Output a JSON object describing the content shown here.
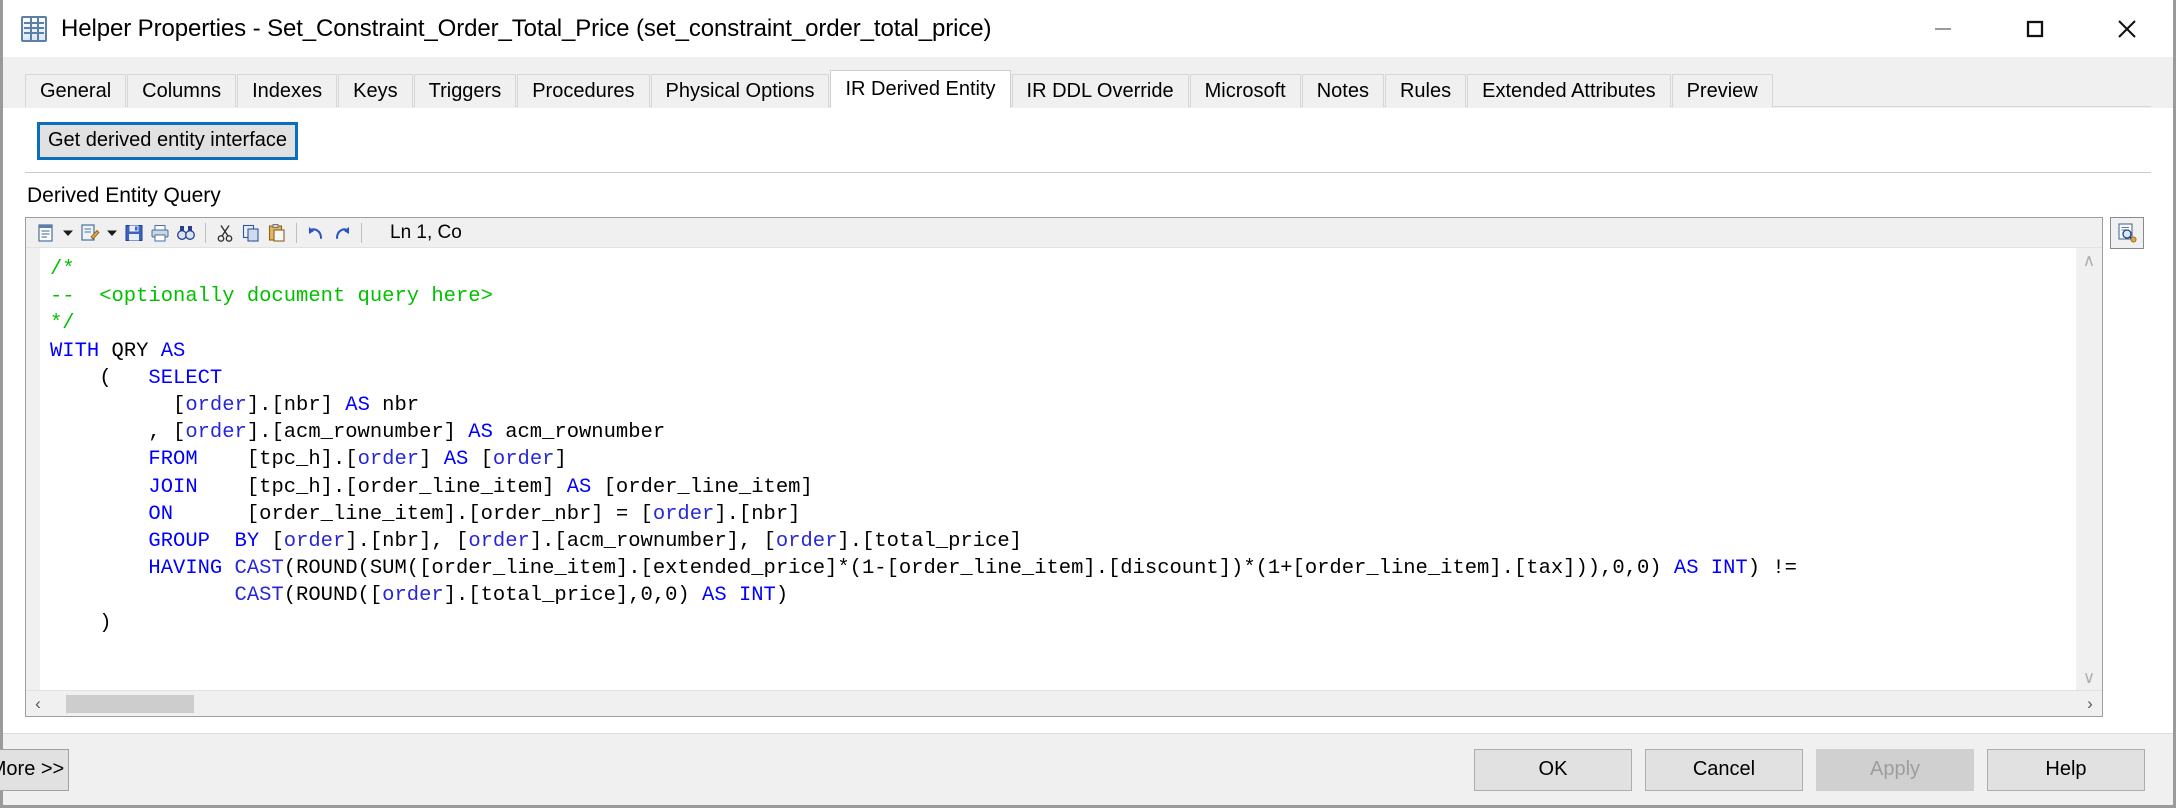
{
  "window": {
    "title": "Helper Properties - Set_Constraint_Order_Total_Price (set_constraint_order_total_price)",
    "icon": "table-grid-icon",
    "controls": {
      "minimize": "minimize-icon",
      "maximize": "maximize-icon",
      "close": "close-icon"
    }
  },
  "tabs": [
    {
      "label": "General",
      "active": false
    },
    {
      "label": "Columns",
      "active": false
    },
    {
      "label": "Indexes",
      "active": false
    },
    {
      "label": "Keys",
      "active": false
    },
    {
      "label": "Triggers",
      "active": false
    },
    {
      "label": "Procedures",
      "active": false
    },
    {
      "label": "Physical Options",
      "active": false
    },
    {
      "label": "IR Derived Entity",
      "active": true
    },
    {
      "label": "IR DDL Override",
      "active": false
    },
    {
      "label": "Microsoft",
      "active": false
    },
    {
      "label": "Notes",
      "active": false
    },
    {
      "label": "Rules",
      "active": false
    },
    {
      "label": "Extended Attributes",
      "active": false
    },
    {
      "label": "Preview",
      "active": false
    }
  ],
  "content": {
    "get_interface_button": "Get derived entity interface",
    "query_group_label": "Derived Entity Query"
  },
  "editor": {
    "toolbar": [
      {
        "name": "insert-template-icon",
        "caret": true
      },
      {
        "name": "edit-query-icon",
        "caret": true
      },
      {
        "name": "save-icon",
        "caret": false
      },
      {
        "name": "print-icon",
        "caret": false
      },
      {
        "name": "find-icon",
        "caret": false
      },
      {
        "name": "cut-icon",
        "caret": false
      },
      {
        "name": "copy-icon",
        "caret": false
      },
      {
        "name": "paste-icon",
        "caret": false
      },
      {
        "name": "undo-icon",
        "caret": false
      },
      {
        "name": "redo-icon",
        "caret": false
      }
    ],
    "cursor_position": "Ln 1, Co",
    "side_button_icon": "preview-query-icon",
    "scroll": {
      "up_arrow": "∧",
      "down_arrow": "∨",
      "left_arrow": "‹",
      "right_arrow": "›"
    },
    "code_lines": [
      [
        {
          "t": "/*",
          "c": "cm"
        }
      ],
      [
        {
          "t": "--  <optionally document query here>",
          "c": "cm"
        }
      ],
      [
        {
          "t": "*/",
          "c": "cm"
        }
      ],
      [
        {
          "t": "WITH",
          "c": "kw"
        },
        {
          "t": " QRY ",
          "c": ""
        },
        {
          "t": "AS",
          "c": "kw"
        }
      ],
      [
        {
          "t": "    (   ",
          "c": ""
        },
        {
          "t": "SELECT",
          "c": "kw"
        }
      ],
      [
        {
          "t": "          [",
          "c": ""
        },
        {
          "t": "order",
          "c": "id"
        },
        {
          "t": "].[nbr] ",
          "c": ""
        },
        {
          "t": "AS",
          "c": "kw"
        },
        {
          "t": " nbr",
          "c": ""
        }
      ],
      [
        {
          "t": "        , [",
          "c": ""
        },
        {
          "t": "order",
          "c": "id"
        },
        {
          "t": "].[acm_rownumber] ",
          "c": ""
        },
        {
          "t": "AS",
          "c": "kw"
        },
        {
          "t": " acm_rownumber",
          "c": ""
        }
      ],
      [
        {
          "t": "        ",
          "c": ""
        },
        {
          "t": "FROM",
          "c": "kw"
        },
        {
          "t": "    [tpc_h].[",
          "c": ""
        },
        {
          "t": "order",
          "c": "id"
        },
        {
          "t": "] ",
          "c": ""
        },
        {
          "t": "AS",
          "c": "kw"
        },
        {
          "t": " [",
          "c": ""
        },
        {
          "t": "order",
          "c": "id"
        },
        {
          "t": "]",
          "c": ""
        }
      ],
      [
        {
          "t": "        ",
          "c": ""
        },
        {
          "t": "JOIN",
          "c": "kw"
        },
        {
          "t": "    [tpc_h].[order_line_item] ",
          "c": ""
        },
        {
          "t": "AS",
          "c": "kw"
        },
        {
          "t": " [order_line_item]",
          "c": ""
        }
      ],
      [
        {
          "t": "        ",
          "c": ""
        },
        {
          "t": "ON",
          "c": "kw"
        },
        {
          "t": "      [order_line_item].[order_nbr] = [",
          "c": ""
        },
        {
          "t": "order",
          "c": "id"
        },
        {
          "t": "].[nbr]",
          "c": ""
        }
      ],
      [
        {
          "t": "        ",
          "c": ""
        },
        {
          "t": "GROUP",
          "c": "kw"
        },
        {
          "t": "  ",
          "c": ""
        },
        {
          "t": "BY",
          "c": "kw"
        },
        {
          "t": " [",
          "c": ""
        },
        {
          "t": "order",
          "c": "id"
        },
        {
          "t": "].[nbr], [",
          "c": ""
        },
        {
          "t": "order",
          "c": "id"
        },
        {
          "t": "].[acm_rownumber], [",
          "c": ""
        },
        {
          "t": "order",
          "c": "id"
        },
        {
          "t": "].[total_price]",
          "c": ""
        }
      ],
      [
        {
          "t": "        ",
          "c": ""
        },
        {
          "t": "HAVING ",
          "c": "kw"
        },
        {
          "t": "CAST",
          "c": "id"
        },
        {
          "t": "(ROUND(SUM([order_line_item].[extended_price]*(1-[order_line_item].[discount])*(1+[order_line_item].[tax])),0,0) ",
          "c": ""
        },
        {
          "t": "AS INT",
          "c": "kw"
        },
        {
          "t": ") !=",
          "c": ""
        }
      ],
      [
        {
          "t": "               ",
          "c": ""
        },
        {
          "t": "CAST",
          "c": "id"
        },
        {
          "t": "(ROUND([",
          "c": ""
        },
        {
          "t": "order",
          "c": "id"
        },
        {
          "t": "].[total_price],0,0) ",
          "c": ""
        },
        {
          "t": "AS",
          "c": "kw"
        },
        {
          "t": " ",
          "c": ""
        },
        {
          "t": "INT",
          "c": "kw"
        },
        {
          "t": ")",
          "c": ""
        }
      ],
      [
        {
          "t": "    )",
          "c": ""
        }
      ]
    ]
  },
  "footer": {
    "more_button": "More >>",
    "buttons": [
      {
        "label": "OK",
        "disabled": false
      },
      {
        "label": "Cancel",
        "disabled": false
      },
      {
        "label": "Apply",
        "disabled": true
      },
      {
        "label": "Help",
        "disabled": false
      }
    ]
  },
  "colors": {
    "accent": "#0a6ebd",
    "keyword": "#0000ff",
    "comment": "#00c000",
    "identifier": "#2727d8",
    "chrome": "#f0f0f0"
  }
}
